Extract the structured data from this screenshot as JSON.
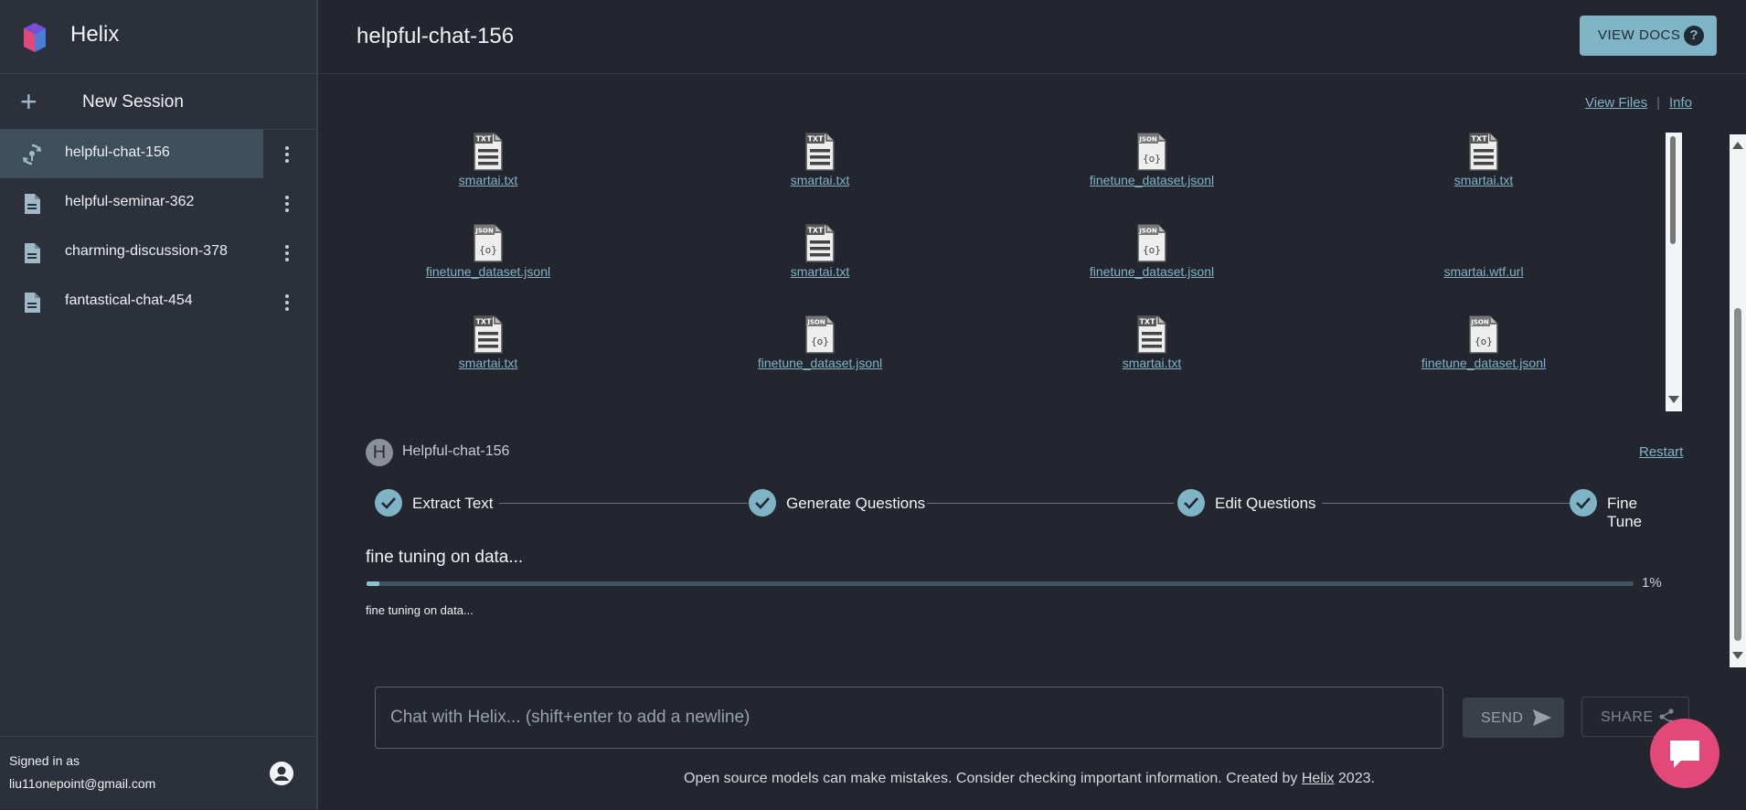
{
  "app": {
    "name": "Helix"
  },
  "sidebar": {
    "new_session_label": "New Session",
    "sessions": [
      {
        "label": "helpful-chat-156",
        "icon": "fine-tune-icon",
        "active": true
      },
      {
        "label": "helpful-seminar-362",
        "icon": "document-icon",
        "active": false
      },
      {
        "label": "charming-discussion-378",
        "icon": "document-icon",
        "active": false
      },
      {
        "label": "fantastical-chat-454",
        "icon": "document-icon",
        "active": false
      }
    ],
    "signed_in_label": "Signed in as",
    "user_email": "liu11onepoint@gmail.com"
  },
  "header": {
    "title": "helpful-chat-156",
    "view_docs_label": "VIEW DOCS",
    "help_glyph": "?"
  },
  "links": {
    "view_files": "View Files",
    "separator": "|",
    "info": "Info"
  },
  "files": [
    {
      "name": "smartai.txt",
      "type": "TXT"
    },
    {
      "name": "smartai.txt",
      "type": "TXT"
    },
    {
      "name": "finetune_dataset.jsonl",
      "type": "JSON"
    },
    {
      "name": "smartai.txt",
      "type": "TXT"
    },
    {
      "name": "finetune_dataset.jsonl",
      "type": "JSON"
    },
    {
      "name": "smartai.txt",
      "type": "TXT"
    },
    {
      "name": "finetune_dataset.jsonl",
      "type": "JSON"
    },
    {
      "name": "smartai.wtf.url",
      "type": ""
    },
    {
      "name": "smartai.txt",
      "type": "TXT"
    },
    {
      "name": "finetune_dataset.jsonl",
      "type": "JSON"
    },
    {
      "name": "smartai.txt",
      "type": "TXT"
    },
    {
      "name": "finetune_dataset.jsonl",
      "type": "JSON"
    }
  ],
  "session": {
    "avatar_letter": "H",
    "name": "Helpful-chat-156",
    "restart_label": "Restart",
    "steps": [
      "Extract Text",
      "Generate Questions",
      "Edit Questions",
      "Fine Tune"
    ],
    "status_title": "fine tuning on data...",
    "progress_percent": 1,
    "progress_label": "1%",
    "status_detail": "fine tuning on data..."
  },
  "chat": {
    "placeholder": "Chat with Helix... (shift+enter to add a newline)",
    "send_label": "SEND",
    "share_label": "SHARE"
  },
  "footer": {
    "text_before": "Open source models can make mistakes. Consider checking important information. Created by",
    "link_text": "Helix",
    "text_after": "2023."
  },
  "colors": {
    "accent": "#7fb3c6",
    "fab": "#e2497a",
    "background": "#23262f",
    "sidebar": "#2c303a"
  }
}
